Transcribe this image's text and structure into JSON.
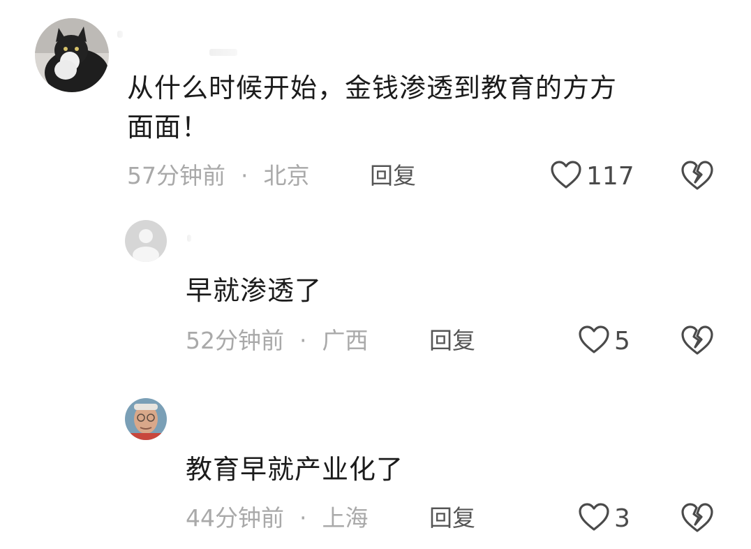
{
  "comments": [
    {
      "text": "从什么时候开始，金钱渗透到教育的方方\n面面！",
      "time": "57分钟前",
      "location": "北京",
      "reply_label": "回复",
      "likes": "117"
    },
    {
      "text": "早就渗透了",
      "time": "52分钟前",
      "location": "广西",
      "reply_label": "回复",
      "likes": "5"
    },
    {
      "text": "教育早就产业化了",
      "time": "44分钟前",
      "location": "上海",
      "reply_label": "回复",
      "likes": "3"
    }
  ],
  "separator": "·",
  "colors": {
    "meta_gray": "#a9a9a9",
    "reply_gray": "#555555",
    "icon_gray": "#4a4a4a",
    "text_dark": "#1b1b1b"
  },
  "icons": {
    "like": "heart-outline-icon",
    "dislike": "broken-heart-icon"
  }
}
